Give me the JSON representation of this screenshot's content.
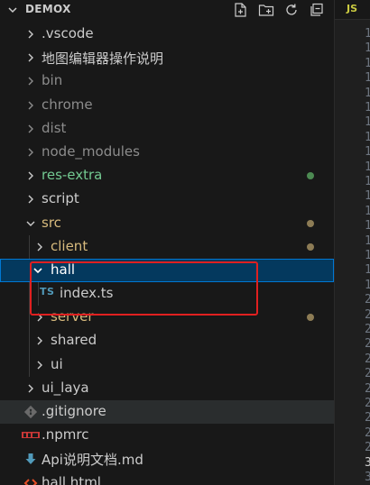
{
  "explorer": {
    "title": "DEMOX",
    "actions": [
      {
        "name": "new-file",
        "icon": "new-file-icon"
      },
      {
        "name": "new-folder",
        "icon": "new-folder-icon"
      },
      {
        "name": "refresh",
        "icon": "refresh-icon"
      },
      {
        "name": "collapse-all",
        "icon": "collapse-all-icon"
      }
    ],
    "items": [
      {
        "label": ".vscode"
      },
      {
        "label": "地图编辑器操作说明"
      },
      {
        "label": "bin"
      },
      {
        "label": "chrome"
      },
      {
        "label": "dist"
      },
      {
        "label": "node_modules"
      },
      {
        "label": "res-extra"
      },
      {
        "label": "script"
      },
      {
        "label": "src"
      },
      {
        "label": "client"
      },
      {
        "label": "hall"
      },
      {
        "label": "index.ts",
        "icon_text": "TS"
      },
      {
        "label": "server"
      },
      {
        "label": "shared"
      },
      {
        "label": "ui"
      },
      {
        "label": "ui_laya"
      },
      {
        "label": ".gitignore"
      },
      {
        "label": ".npmrc"
      },
      {
        "label": "Api说明文档.md"
      },
      {
        "label": "hall.html"
      }
    ]
  },
  "editor": {
    "tab_icon_text": "JS",
    "line_numbers": [
      "1",
      "1",
      "1",
      "1",
      "1",
      "1",
      "1",
      "1",
      "1",
      "1",
      "1",
      "1",
      "1",
      "1",
      "1",
      "1",
      "1",
      "1",
      "2",
      "2",
      "2",
      "2",
      "2",
      "2",
      "2",
      "2",
      "2",
      "2",
      "2",
      "3",
      "3"
    ]
  },
  "colors": {
    "selected_bg": "#04395e",
    "selected_border": "#0078d4",
    "highlight_box": "#e02020",
    "modified_dot": "#8d7c55",
    "untracked_dot": "#4c8a52",
    "modified_text": "#d7ba7d",
    "untracked_text": "#73c991",
    "ignored_text": "#8c8c8c"
  }
}
